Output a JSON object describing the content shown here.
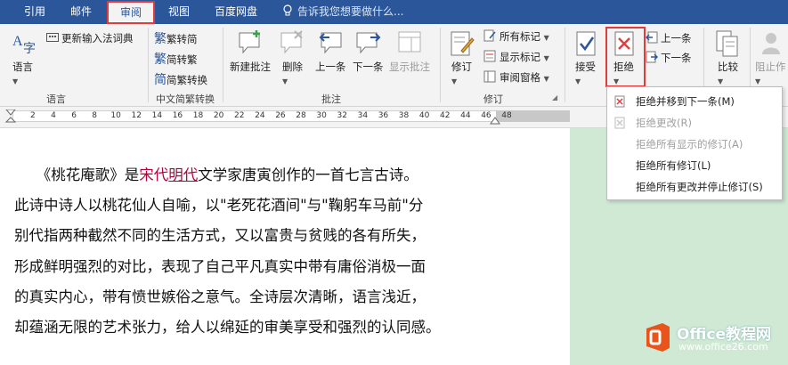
{
  "tabs": [
    {
      "label": "引用",
      "active": false
    },
    {
      "label": "邮件",
      "active": false
    },
    {
      "label": "审阅",
      "active": true
    },
    {
      "label": "视图",
      "active": false
    },
    {
      "label": "百度网盘",
      "active": false
    }
  ],
  "tell_me": "告诉我您想要做什么...",
  "ribbon": {
    "language": {
      "language_btn": "语言",
      "update_ime": "更新输入法词典",
      "group": "语言"
    },
    "chinese": {
      "to_traditional": "繁转简",
      "to_simplified": "简转繁",
      "convert": "简繁转换",
      "group": "中文简繁转换"
    },
    "comments": {
      "new": "新建批注",
      "delete": "删除",
      "prev": "上一条",
      "next": "下一条",
      "show": "显示批注",
      "group": "批注"
    },
    "tracking": {
      "track": "修订",
      "markup": "所有标记",
      "show_markup": "显示标记",
      "pane": "审阅窗格",
      "group": "修订"
    },
    "changes": {
      "accept": "接受",
      "reject": "拒绝",
      "prev": "上一条",
      "next": "下一条"
    },
    "compare": {
      "label": "比较"
    },
    "protect": {
      "label": "阻止作"
    }
  },
  "ruler": {
    "ticks": [
      "2",
      "4",
      "6",
      "8",
      "10",
      "12",
      "14",
      "16",
      "18",
      "20",
      "22",
      "24",
      "26",
      "28",
      "30",
      "32",
      "34",
      "36",
      "38",
      "40",
      "42",
      "44",
      "46",
      "48"
    ]
  },
  "document": {
    "line1": {
      "pre": "《桃花庵歌》是",
      "link_a": "宋代",
      "link_b": "明代",
      "post": "文学家唐寅创作的一首七言古诗。"
    },
    "lines": [
      "此诗中诗人以桃花仙人自喻，以\"老死花酒间\"与\"鞠躬车马前\"分",
      "别代指两种截然不同的生活方式，又以富贵与贫贱的各有所失，",
      "形成鲜明强烈的对比，表现了自己平凡真实中带有庸俗消极一面",
      "的真实内心，带有愤世嫉俗之意气。全诗层次清晰，语言浅近，",
      "却蕴涵无限的艺术张力，给人以绵延的审美享受和强烈的认同感。"
    ]
  },
  "reject_menu": [
    {
      "label": "拒绝并移到下一条(M)",
      "enabled": true
    },
    {
      "label": "拒绝更改(R)",
      "enabled": false
    },
    {
      "label": "拒绝所有显示的修订(A)",
      "enabled": false
    },
    {
      "label": "拒绝所有修订(L)",
      "enabled": true
    },
    {
      "label": "拒绝所有更改并停止修订(S)",
      "enabled": true
    }
  ],
  "logo": {
    "name": "Office教程网",
    "url": "www.office26.com"
  },
  "colors": {
    "tab_bar": "#2b579a",
    "highlight": "#e03c3c",
    "link": "#b3003a",
    "side_panel": "#cfe9d5",
    "logo": "#e8541c"
  }
}
